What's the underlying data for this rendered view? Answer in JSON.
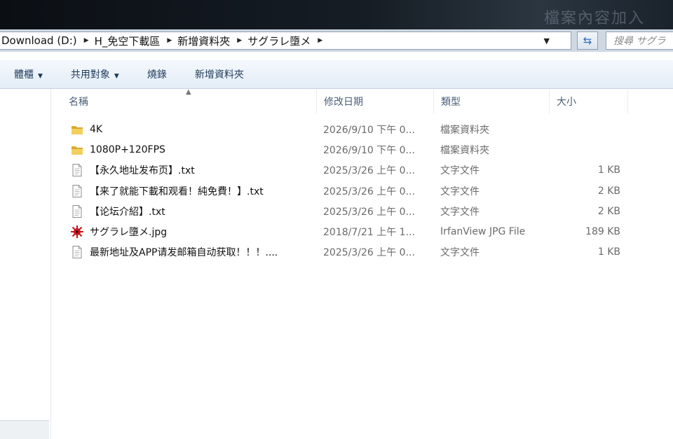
{
  "window": {
    "title_ghost": "檔案內容加入"
  },
  "address": {
    "crumbs": [
      "Download (D:)",
      "H_免空下載區",
      "新增資料夾",
      "サグラレ墮メ"
    ],
    "search_placeholder": "搜尋 サグラ"
  },
  "toolbar": {
    "organize": "體櫃",
    "share": "共用對象",
    "burn": "燒錄",
    "new_folder": "新增資料夾"
  },
  "columns": {
    "name": "名稱",
    "date": "修改日期",
    "type": "類型",
    "size": "大小"
  },
  "files": [
    {
      "icon": "folder-icon",
      "name": "4K",
      "date": "2026/9/10 下午 0...",
      "type": "檔案資料夾",
      "size": ""
    },
    {
      "icon": "folder-icon",
      "name": "1080P+120FPS",
      "date": "2026/9/10 下午 0...",
      "type": "檔案資料夾",
      "size": ""
    },
    {
      "icon": "text-file-icon",
      "name": "【永久地址发布页】.txt",
      "date": "2025/3/26 上午 0...",
      "type": "文字文件",
      "size": "1 KB"
    },
    {
      "icon": "text-file-icon",
      "name": "【来了就能下載和观看！純免費！】.txt",
      "date": "2025/3/26 上午 0...",
      "type": "文字文件",
      "size": "2 KB"
    },
    {
      "icon": "text-file-icon",
      "name": "【论坛介紹】.txt",
      "date": "2025/3/26 上午 0...",
      "type": "文字文件",
      "size": "2 KB"
    },
    {
      "icon": "image-file-icon",
      "name": "サグラレ墮メ.jpg",
      "date": "2018/7/21 上午 1...",
      "type": "IrfanView JPG File",
      "size": "189 KB"
    },
    {
      "icon": "text-file-icon",
      "name": "最新地址及APP请发邮箱自动获取！！！....",
      "date": "2025/3/26 上午 0...",
      "type": "文字文件",
      "size": "1 KB"
    }
  ],
  "colors": {
    "accent": "#2f6db3",
    "folder": "#e8b93c"
  }
}
